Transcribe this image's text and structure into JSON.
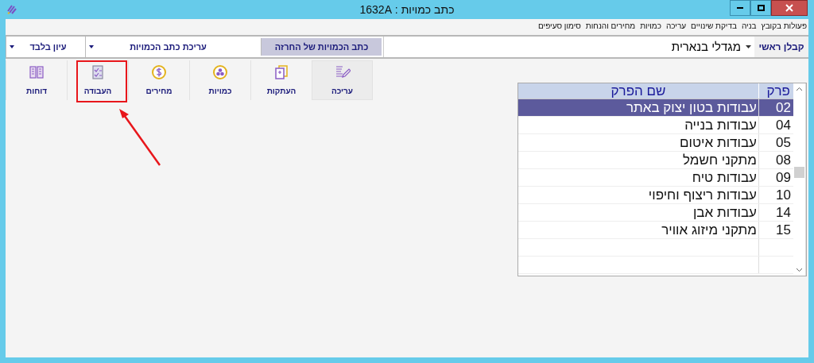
{
  "window": {
    "title": "כתב כמויות : 1632A"
  },
  "menu": [
    "פעולות בקובץ",
    "בניה",
    "בדיקת שינויים",
    "עריכה",
    "כמויות",
    "מחירים והנחות",
    "סימון סעיפים"
  ],
  "contractor": {
    "label": "קבלן ראשי",
    "value": "מגדלי בנארית"
  },
  "mode_buttons": [
    {
      "label": "כתב הכמויות של החרזה",
      "kind": "button",
      "selected": true
    },
    {
      "label": "עריכת כתב הכמויות",
      "kind": "dropdown",
      "selected": false
    },
    {
      "label": "עיון בלבד",
      "kind": "dropdown",
      "selected": false
    }
  ],
  "tools": [
    {
      "label": "עריכה",
      "kind": "edit",
      "selected": true
    },
    {
      "label": "העתקות",
      "kind": "copy",
      "selected": false
    },
    {
      "label": "כמויות",
      "kind": "quantities",
      "selected": false
    },
    {
      "label": "מחירים",
      "kind": "prices",
      "selected": false
    },
    {
      "label": "העבודה",
      "kind": "work",
      "selected": false
    },
    {
      "label": "דוחות",
      "kind": "reports",
      "selected": false
    }
  ],
  "table": {
    "columns": [
      "פרק",
      "שם הפרק"
    ],
    "rows": [
      {
        "cells": [
          "02",
          "עבודות בטון יצוק באתר"
        ],
        "selected": true
      },
      {
        "cells": [
          "04",
          "עבודות בנייה"
        ],
        "selected": false
      },
      {
        "cells": [
          "05",
          "עבודות איטום"
        ],
        "selected": false
      },
      {
        "cells": [
          "08",
          "מתקני חשמל"
        ],
        "selected": false
      },
      {
        "cells": [
          "09",
          "עבודות טיח"
        ],
        "selected": false
      },
      {
        "cells": [
          "10",
          "עבודות ריצוף וחיפוי"
        ],
        "selected": false
      },
      {
        "cells": [
          "14",
          "עבודות אבן"
        ],
        "selected": false
      },
      {
        "cells": [
          "15",
          "מתקני מיזוג אוויר"
        ],
        "selected": false
      }
    ]
  }
}
